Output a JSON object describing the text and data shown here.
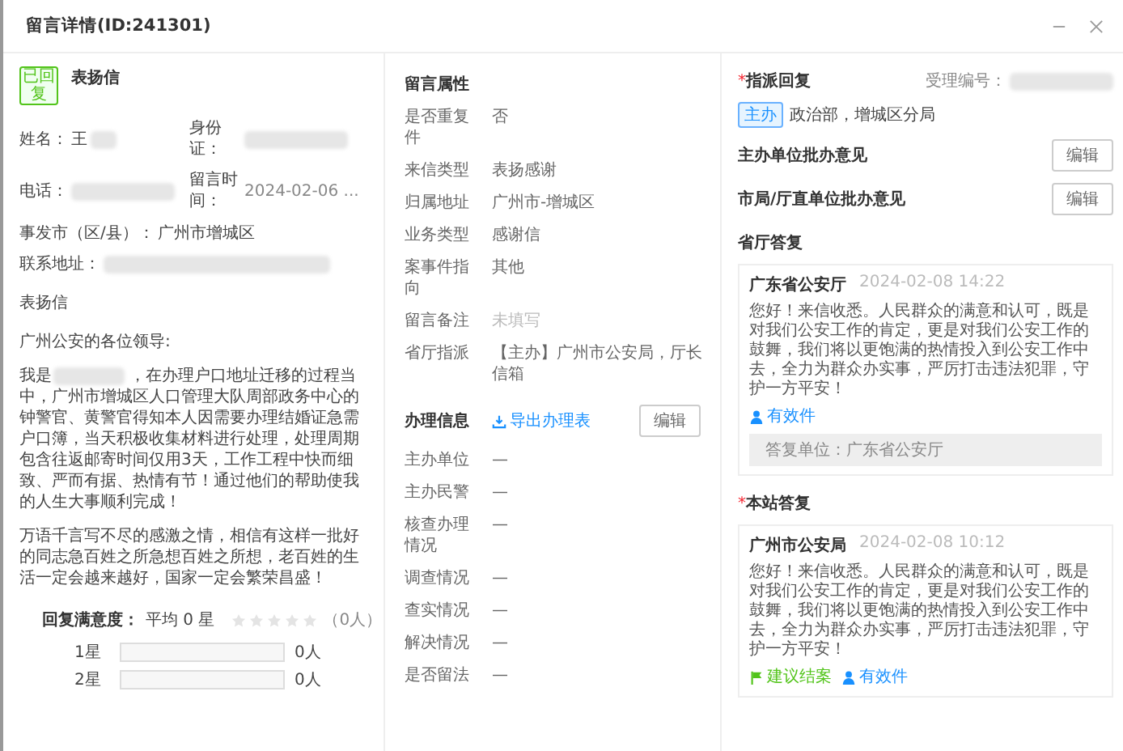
{
  "dialog": {
    "title": "留言详情(ID:241301)"
  },
  "letter": {
    "status_tag": "已回复",
    "type": "表扬信",
    "fields": [
      {
        "label": "姓名：",
        "value": "王",
        "kind": "partly_hidden"
      },
      {
        "label": "身份证：",
        "kind": "hidden"
      },
      {
        "label": "电话：",
        "kind": "hidden"
      },
      {
        "label": "留言时间：",
        "value": "2024-02-06 ...",
        "kind": "muted"
      },
      {
        "label": "事发市（区/县）：",
        "value": "广州市增城区",
        "kind": "text"
      },
      {
        "label": "联系地址：",
        "kind": "hidden"
      }
    ],
    "subject": "表扬信",
    "greeting": "广州公安的各位领导:",
    "paragraphs": [
      {
        "lead": "我是",
        "hidden_name": true,
        "text": "，在办理户口地址迁移的过程当中，广州市增城区人口管理大队周部政务中心的钟警官、黄警官得知本人因需要办理结婚证急需户口簿，当天积极收集材料进行处理，处理周期包含往返邮寄时间仅用3天，工作工程中快而细致、严而有据、热情有节！通过他们的帮助使我的人生大事顺利完成！"
      },
      {
        "hidden_name": false,
        "text": "万语千言写不尽的感激之情，相信有这样一批好的同志急百姓之所急想百姓之所想，老百姓的生活一定会越来越好，国家一定会繁荣昌盛！"
      }
    ],
    "rating": {
      "label": "回复满意度：",
      "average": "平均 0 星",
      "stars": 0,
      "count": "（0人）",
      "rows": [
        {
          "label": "1星",
          "level": 0,
          "count": "0人"
        },
        {
          "label": "2星",
          "level": 0,
          "count": "0人"
        }
      ]
    }
  },
  "attributes": {
    "title": "留言属性",
    "items": [
      {
        "label": "是否重复件",
        "value": "否",
        "unfilled": false
      },
      {
        "label": "来信类型",
        "value": "表扬感谢",
        "unfilled": false
      },
      {
        "label": "归属地址",
        "value": "广州市-增城区",
        "unfilled": false
      },
      {
        "label": "业务类型",
        "value": "感谢信",
        "unfilled": false
      },
      {
        "label": "案事件指向",
        "value": "其他",
        "unfilled": false
      },
      {
        "label": "留言备注",
        "value": "未填写",
        "unfilled": true
      },
      {
        "label": "省厅指派",
        "value": "【主办】广州市公安局，厅长信箱",
        "unfilled": false
      }
    ]
  },
  "handling": {
    "title": "办理信息",
    "export_link": "导出办理表",
    "edit_button": "编辑",
    "items": [
      {
        "label": "主办单位",
        "value": "—"
      },
      {
        "label": "主办民警",
        "value": "—"
      },
      {
        "label": "核查办理情况",
        "value": "—"
      },
      {
        "label": "调查情况",
        "value": "—"
      },
      {
        "label": "查实情况",
        "value": "—"
      },
      {
        "label": "解决情况",
        "value": "—"
      },
      {
        "label": "是否留法",
        "value": "—"
      }
    ]
  },
  "assignment": {
    "title": "指派回复",
    "required_mark": "*",
    "accept_label": "受理编号：",
    "tag": "主办",
    "units": "政治部，增城区分局",
    "opinions": [
      {
        "label": "主办单位批办意见",
        "button": "编辑"
      },
      {
        "label": "市局/厅直单位批办意见",
        "button": "编辑"
      }
    ]
  },
  "replies": [
    {
      "title": "省厅答复",
      "author": "广东省公安厅",
      "time": "2024-02-08 14:22",
      "text": "您好！来信收悉。人民群众的满意和认可，既是对我们公安工作的肯定，更是对我们公安工作的鼓舞，我们将以更饱满的热情投入到公安工作中去，全力为群众办实事，严厉打击违法犯罪，守护一方平安！",
      "links": [
        {
          "kind": "valid",
          "label": "有效件"
        }
      ],
      "footer": "答复单位：广东省公安厅"
    },
    {
      "title": "本站答复",
      "required_mark": "*",
      "author": "广州市公安局",
      "time": "2024-02-08 10:12",
      "text": "您好！来信收悉。人民群众的满意和认可，既是对我们公安工作的肯定，更是对我们公安工作的鼓舞，我们将以更饱满的热情投入到公安工作中去，全力为群众办实事，严厉打击违法犯罪，守护一方平安！",
      "links": [
        {
          "kind": "close_case",
          "label": "建议结案"
        },
        {
          "kind": "valid",
          "label": "有效件"
        }
      ]
    }
  ]
}
